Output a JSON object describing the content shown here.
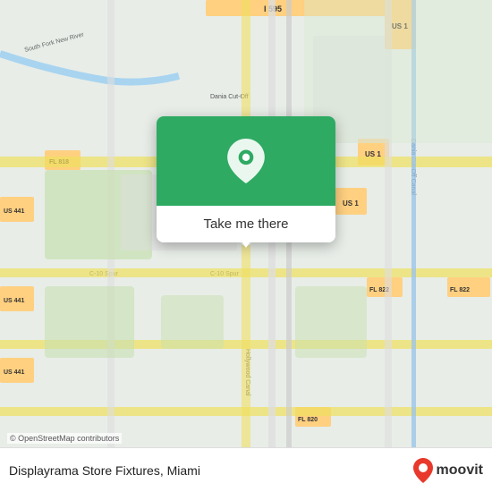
{
  "map": {
    "attribution": "© OpenStreetMap contributors",
    "backgroundColor": "#e8f0e8"
  },
  "popup": {
    "button_label": "Take me there",
    "pin_color": "#2eaa62"
  },
  "footer": {
    "store_name": "Displayrama Store Fixtures, Miami",
    "moovit_label": "moovit"
  },
  "icons": {
    "location_pin": "location-pin-icon",
    "moovit_pin": "moovit-pin-icon"
  }
}
